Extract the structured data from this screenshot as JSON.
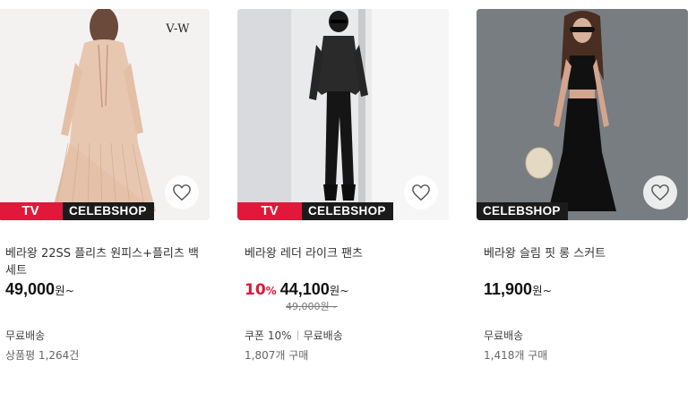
{
  "products": [
    {
      "brand_mark": "V-W",
      "badge_tv": "TV",
      "badge_celeb": "CELEBSHOP",
      "title": "베라왕 22SS 플리츠 원피스+플리츠 백 세트",
      "discount": "",
      "discount_unit": "",
      "price": "49,000",
      "price_unit": "원~",
      "original_price": "",
      "meta1": "무료배송",
      "meta1b": "",
      "meta2": "상품평 1,264건",
      "heart_icon": "heart-outline-icon"
    },
    {
      "brand_mark": "",
      "badge_tv": "TV",
      "badge_celeb": "CELEBSHOP",
      "title": "베라왕 레더 라이크 팬츠",
      "discount": "10",
      "discount_unit": "%",
      "price": "44,100",
      "price_unit": "원~",
      "original_price": "49,000원~",
      "meta1": "쿠폰 10%",
      "meta1b": "무료배송",
      "meta2": "1,807개 구매",
      "heart_icon": "heart-outline-icon"
    },
    {
      "brand_mark": "",
      "badge_tv": "",
      "badge_celeb": "CELEBSHOP",
      "title": "베라왕 슬림 핏 롱 스커트",
      "discount": "",
      "discount_unit": "",
      "price": "11,900",
      "price_unit": "원~",
      "original_price": "",
      "meta1": "무료배송",
      "meta1b": "",
      "meta2": "1,418개 구매",
      "heart_icon": "heart-outline-icon"
    }
  ],
  "colors": {
    "accent": "#e1183a",
    "badge_dark": "#1b1b1b"
  }
}
